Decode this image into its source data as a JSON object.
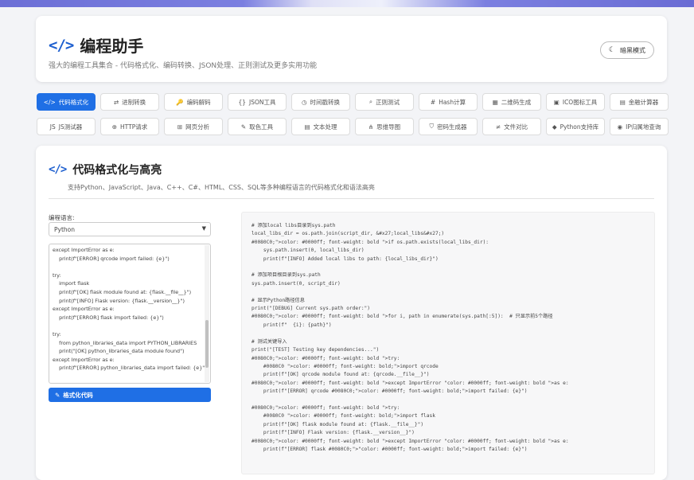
{
  "app": {
    "logo_glyph": "</>",
    "title": "编程助手",
    "subtitle": "强大的编程工具集合 - 代码格式化、编码转换、JSON处理、正则测试及更多实用功能",
    "theme_toggle": {
      "icon": "moon-icon",
      "glyph": "☾",
      "label": "暗黑模式"
    }
  },
  "tools": {
    "row1": [
      {
        "label": "代码格式化",
        "glyph": "</>",
        "icon": "code-icon",
        "active": true
      },
      {
        "label": "进制转换",
        "glyph": "⇄",
        "icon": "exchange-icon"
      },
      {
        "label": "编码解码",
        "glyph": "🔑",
        "icon": "key-icon"
      },
      {
        "label": "JSON工具",
        "glyph": "{}",
        "icon": "json-icon"
      },
      {
        "label": "时间戳转换",
        "glyph": "◷",
        "icon": "clock-icon"
      },
      {
        "label": "正则测试",
        "glyph": "⌕",
        "icon": "search-icon"
      },
      {
        "label": "Hash计算",
        "glyph": "#",
        "icon": "hash-icon"
      },
      {
        "label": "二维码生成",
        "glyph": "▦",
        "icon": "qrcode-icon"
      },
      {
        "label": "ICO图标工具",
        "glyph": "▣",
        "icon": "image-icon"
      },
      {
        "label": "金融计算器",
        "glyph": "▤",
        "icon": "calculator-icon"
      }
    ],
    "row2": [
      {
        "label": "JS测试器",
        "glyph": "JS",
        "icon": "js-icon"
      },
      {
        "label": "HTTP请求",
        "glyph": "⊕",
        "icon": "globe-icon"
      },
      {
        "label": "网页分析",
        "glyph": "⊞",
        "icon": "table-icon"
      },
      {
        "label": "取色工具",
        "glyph": "✎",
        "icon": "eyedropper-icon"
      },
      {
        "label": "文本处理",
        "glyph": "▤",
        "icon": "file-icon"
      },
      {
        "label": "思维导图",
        "glyph": "⋔",
        "icon": "sitemap-icon"
      },
      {
        "label": "密码生成器",
        "glyph": "⛉",
        "icon": "shield-icon"
      },
      {
        "label": "文件对比",
        "glyph": "≠",
        "icon": "compare-icon"
      },
      {
        "label": "Python支持库",
        "glyph": "◆",
        "icon": "python-icon"
      },
      {
        "label": "IP归属地查询",
        "glyph": "◉",
        "icon": "location-icon"
      }
    ]
  },
  "section": {
    "glyph": "</>",
    "title": "代码格式化与高亮",
    "description": "支持Python、JavaScript、Java、C++、C#、HTML、CSS、SQL等多种编程语言的代码格式化和语法高亮",
    "language_label": "编程语言:",
    "language_value": "Python",
    "format_button": "格式化代码",
    "input_code": "except ImportError as e:\n    print(f\"[ERROR] qrcode import failed: {e}\")\n\ntry:\n    import flask\n    print(f\"[OK] flask module found at: {flask.__file__}\")\n    print(f\"[INFO] Flask version: {flask.__version__}\")\nexcept ImportError as e:\n    print(f\"[ERROR] flask import failed: {e}\")\n\ntry:\n    from python_libraries_data import PYTHON_LIBRARIES\n    print(\"[OK] python_libraries_data module found\")\nexcept ImportError as e:\n    print(f\"[ERROR] python_libraries_data import failed: {e}\")",
    "output_code": "# 添加local libs目录到sys.path\nlocal_libs_dir = os.path.join(script_dir, &#x27;local_libs&#x27;)\n#0080C0;\">color: #0000ff; font-weight: bold \">if os.path.exists(local_libs_dir):\n    sys.path.insert(0, local_libs_dir)\n    print(f\"[INFO] Added local libs to path: {local_libs_dir}\")\n\n# 添加项目根目录到sys.path\nsys.path.insert(0, script_dir)\n\n# 显示Python路径信息\nprint(\"[DEBUG] Current sys.path order:\")\n#0080C0;\">color: #0000ff; font-weight: bold \">for i, path in enumerate(sys.path[:5]):  # 只显示前5个路径\n    print(f\"  {i}: {path}\")\n\n# 测试关键导入\nprint(\"[TEST] Testing key dependencies...\")\n#0080C0;\">color: #0000ff; font-weight: bold \">try:\n    #0080C0 \">color: #0000ff; font-weight: bold;\">import qrcode\n    print(f\"[OK] qrcode module found at: {qrcode.__file__}\")\n#0080C0;\">color: #0000ff; font-weight: bold \">except ImportError \"color: #0000ff; font-weight: bold \">as e:\n    print(f\"[ERROR] qrcode #0080C0;\">color: #0000ff; font-weight: bold;\">import failed: {e}\")\n\n#0080C0;\">color: #0000ff; font-weight: bold \">try:\n    #0080C0 \">color: #0000ff; font-weight: bold;\">import flask\n    print(f\"[OK] flask module found at: {flask.__file__}\")\n    print(f\"[INFO] Flask version: {flask.__version__}\")\n#0080C0;\">color: #0000ff; font-weight: bold \">except ImportError \"color: #0000ff; font-weight: bold \">as e:\n    print(f\"[ERROR] flask #0080C0;\">\"color: #0000ff; font-weight: bold;\">import failed: {e}\")"
  },
  "colors": {
    "accent": "#1f6fe5",
    "logo": "#1d5fcf"
  }
}
